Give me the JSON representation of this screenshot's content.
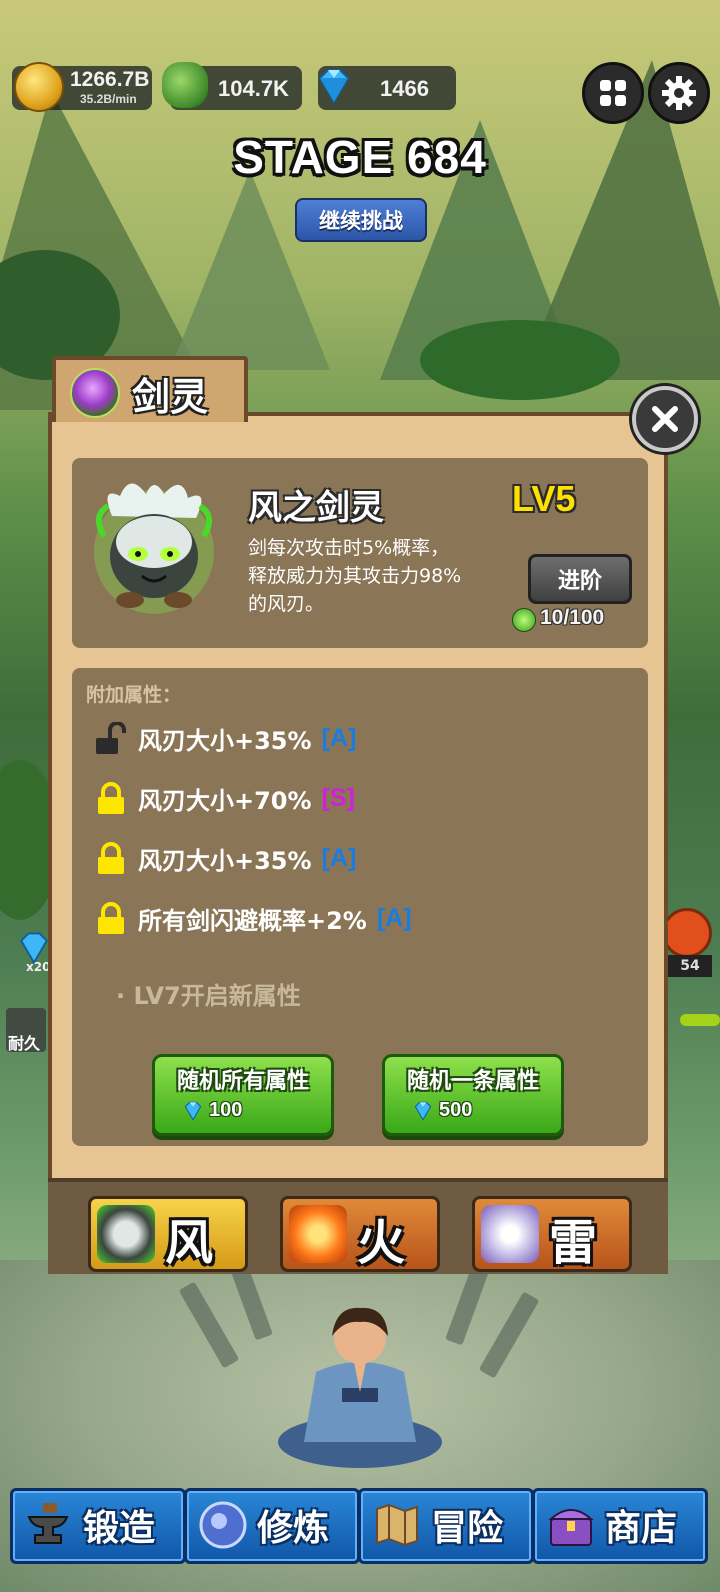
{
  "hud": {
    "gold": "1266.7B",
    "gold_rate": "35.2B/min",
    "jade": "104.7K",
    "gems": "1466"
  },
  "stage": {
    "title": "STAGE 684",
    "continue_label": "继续挑战"
  },
  "side": {
    "gem_mult": "x20",
    "durability_label": "耐久",
    "right_count": "54"
  },
  "dialog": {
    "title": "剑灵",
    "spirit": {
      "name": "风之剑灵",
      "level": "LV5",
      "desc_line1": "剑每次攻击时5%概率，",
      "desc_line2": "释放威力为其攻击力98%",
      "desc_line3": "的风刃。",
      "advance_label": "进阶",
      "fragments": "10/100"
    },
    "attributes": {
      "header": "附加属性：",
      "items": [
        {
          "text": "风刃大小+35%",
          "grade": "[A]",
          "grade_color": "#1a7be0",
          "locked": false
        },
        {
          "text": "风刃大小+70%",
          "grade": "[S]",
          "grade_color": "#d21fd9",
          "locked": true
        },
        {
          "text": "风刃大小+35%",
          "grade": "[A]",
          "grade_color": "#1a7be0",
          "locked": true
        },
        {
          "text": "所有剑闪避概率+2%",
          "grade": "[A]",
          "grade_color": "#1a7be0",
          "locked": true
        }
      ],
      "next_unlock": "·   LV7开启新属性"
    },
    "buttons": {
      "random_all": {
        "label": "随机所有属性",
        "cost": "100"
      },
      "random_one": {
        "label": "随机一条属性",
        "cost": "500"
      }
    },
    "tabs": [
      {
        "label": "风",
        "icon": "wind-spirit-icon"
      },
      {
        "label": "火",
        "icon": "fire-spirit-icon"
      },
      {
        "label": "雷",
        "icon": "thunder-spirit-icon"
      }
    ]
  },
  "nav": [
    {
      "label": "锻造",
      "icon": "anvil-icon"
    },
    {
      "label": "修炼",
      "icon": "orb-icon"
    },
    {
      "label": "冒险",
      "icon": "map-icon"
    },
    {
      "label": "商店",
      "icon": "chest-icon"
    }
  ],
  "colors": {
    "panel": "#e6c592",
    "card": "#8a7556",
    "level": "#ffe100",
    "button_green": "#3aa818",
    "nav_blue": "#1157a8"
  }
}
